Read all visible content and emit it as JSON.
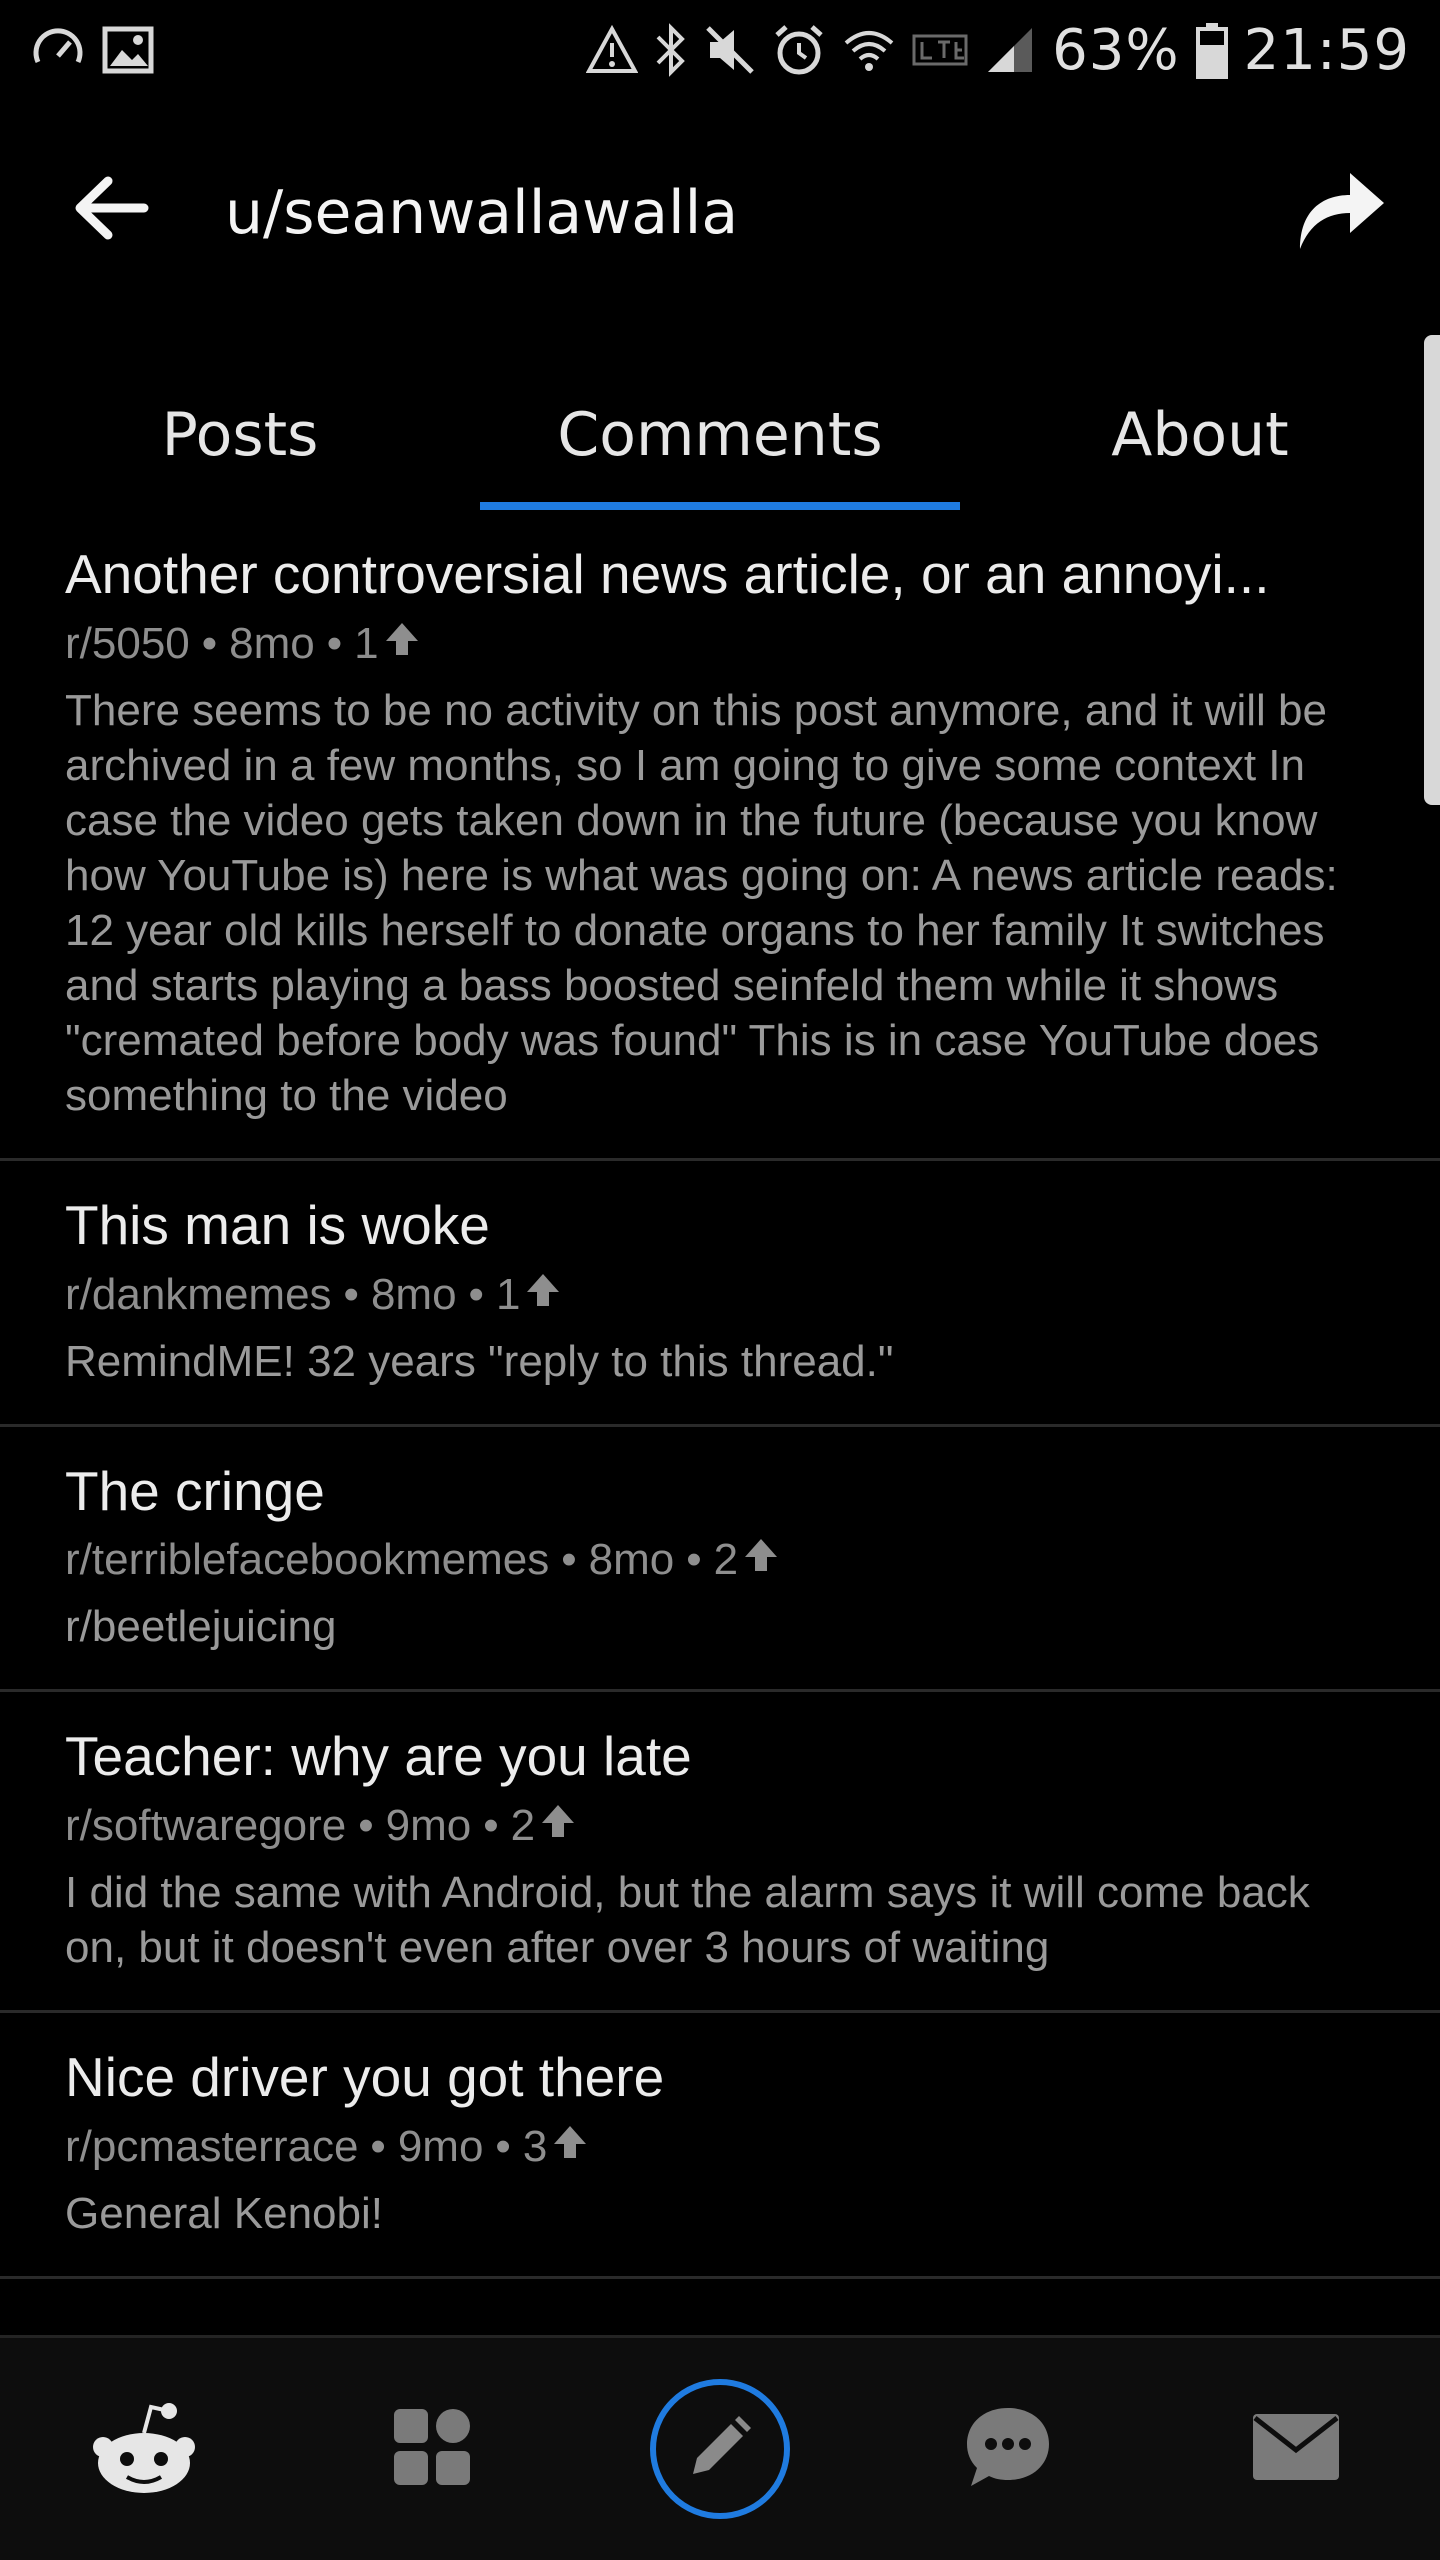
{
  "status_bar": {
    "battery": "63%",
    "time": "21:59",
    "left_icons": [
      "speedometer-icon",
      "image-icon"
    ],
    "right_icons": [
      "warning-icon",
      "bluetooth-icon",
      "mute-icon",
      "alarm-icon",
      "wifi-icon",
      "lte-icon",
      "signal-icon",
      "battery-icon"
    ]
  },
  "header": {
    "title": "u/seanwallawalla",
    "back_icon": "back-arrow-icon",
    "share_icon": "share-icon"
  },
  "tabs": [
    {
      "label": "Posts",
      "active": false
    },
    {
      "label": "Comments",
      "active": true
    },
    {
      "label": "About",
      "active": false
    }
  ],
  "comments": [
    {
      "title": "Another controversial news article, or an annoyi...",
      "subreddit": "r/5050",
      "age": "8mo",
      "score": "1",
      "body": "There seems to be no activity on this post anymore, and it will be archived in a few months, so I am going to give some context In case the video gets taken down in the future (because you know how YouTube is) here is what was going on: A news article reads: 12 year old kills herself to donate organs to her family It switches and starts playing a bass boosted seinfeld them while it shows \"cremated before body was found\" This is in case YouTube does something to the video"
    },
    {
      "title": "This man is woke",
      "subreddit": "r/dankmemes",
      "age": "8mo",
      "score": "1",
      "body": "RemindME! 32 years \"reply to this thread.\""
    },
    {
      "title": "The cringe",
      "subreddit": "r/terriblefacebookmemes",
      "age": "8mo",
      "score": "2",
      "body": "r/beetlejuicing"
    },
    {
      "title": "Teacher: why are you late",
      "subreddit": "r/softwaregore",
      "age": "9mo",
      "score": "2",
      "body": "I did the same with Android, but the alarm says it will come back on, but it doesn't even after over 3 hours of waiting"
    },
    {
      "title": "Nice driver you got there",
      "subreddit": "r/pcmasterrace",
      "age": "9mo",
      "score": "3",
      "body": "General Kenobi!"
    }
  ],
  "meta_separator": "•",
  "bottom_nav": [
    {
      "icon": "snoo-home-icon"
    },
    {
      "icon": "communities-grid-icon"
    },
    {
      "icon": "compose-pencil-icon"
    },
    {
      "icon": "chat-bubble-icon"
    },
    {
      "icon": "mail-icon"
    }
  ],
  "colors": {
    "background": "#000000",
    "accent": "#1f7be0",
    "text_primary": "#ececec",
    "text_secondary": "#8e8e8e"
  }
}
